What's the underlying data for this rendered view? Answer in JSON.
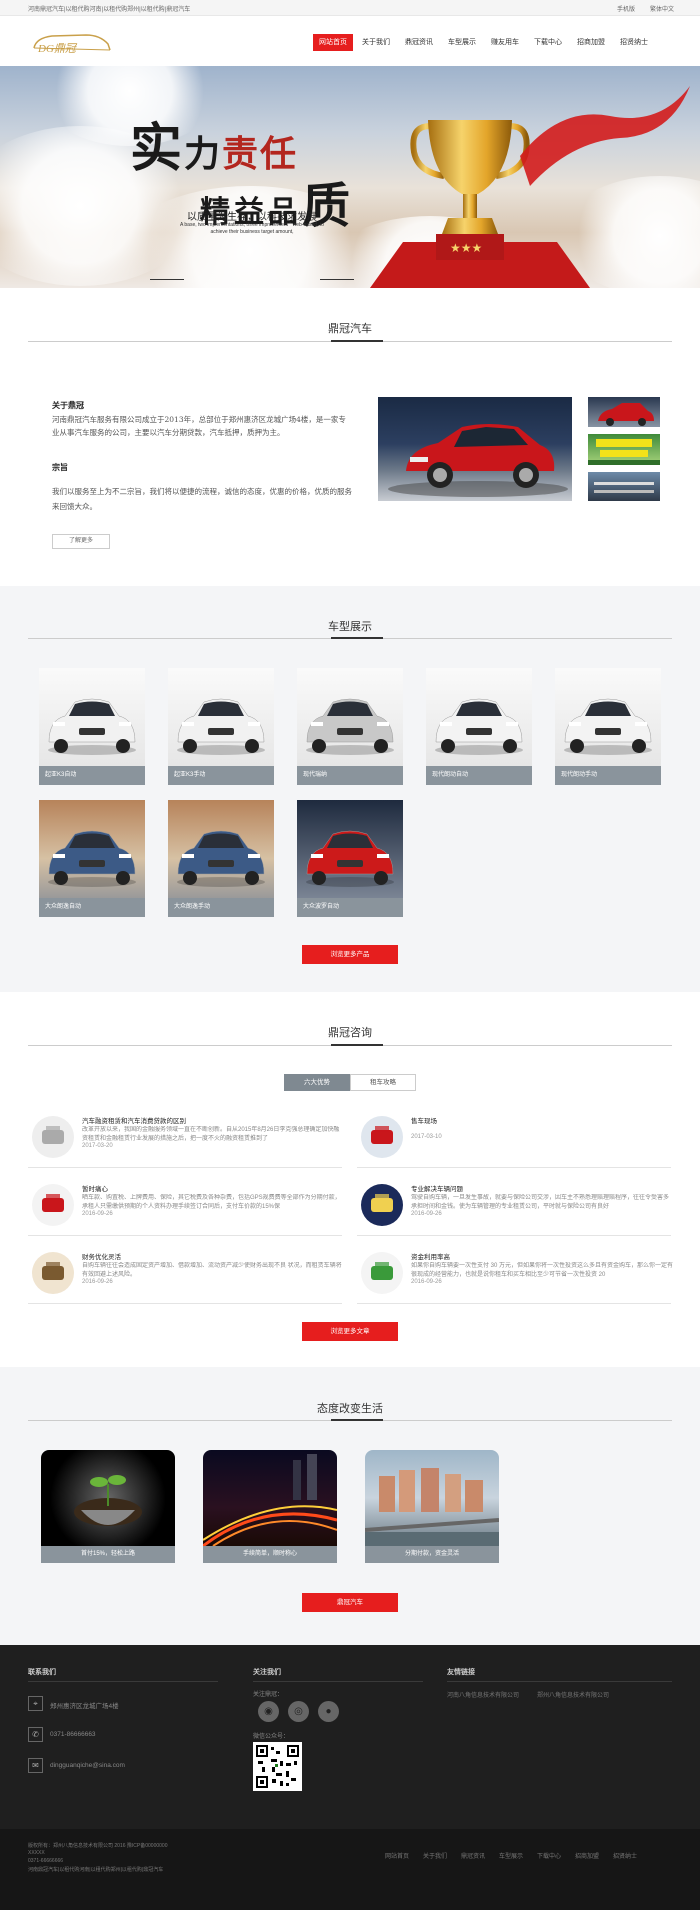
{
  "topbar": {
    "notice": "河南鼎冠汽车|以租代购河南|以租代购郑州|以租代购|鼎冠汽车",
    "mobile": "手机版",
    "lang": "繁体中文"
  },
  "header": {
    "logo_text": "DG鼎冠",
    "nav": [
      "网站首页",
      "关于我们",
      "鼎冠资讯",
      "车型展示",
      "赚友用车",
      "下载中心",
      "招商加盟",
      "招贤纳士"
    ]
  },
  "banner": {
    "title_a": "实",
    "title_b": "力",
    "title_c": "责任",
    "title_d": "精益品",
    "title_e": "质",
    "slogan": "以质量为生存，以科技求发展",
    "slogan_en": "A base, two implementations, three improvement \" web-based, to achieve their business target amount,"
  },
  "about": {
    "section_title": "鼎冠汽车",
    "heading1": "关于鼎冠",
    "text1": "河南鼎冠汽车服务有限公司成立于2013年，总部位于郑州惠济区龙城广场4楼，是一家专业从事汽车服务的公司，主要以汽车分期贷款，汽车抵押，质押为主。",
    "heading2": "宗旨",
    "text2": "我们以服务至上为不二宗旨，我们将以便捷的流程，诚信的态度，优惠的价格，优质的服务来回馈大众。",
    "more": "了解更多"
  },
  "models": {
    "section_title": "车型展示",
    "cars": [
      {
        "name": "起亚K3自动",
        "color": "#f1f1f1"
      },
      {
        "name": "起亚K3手动",
        "color": "#f1f1f1"
      },
      {
        "name": "现代瑞纳",
        "color": "#c8c8c8"
      },
      {
        "name": "现代朗动自动",
        "color": "#f3f3f3"
      },
      {
        "name": "现代朗动手动",
        "color": "#f3f3f3"
      },
      {
        "name": "大众朗逸自动",
        "color": "#3c5a86"
      },
      {
        "name": "大众朗逸手动",
        "color": "#3c5a86"
      },
      {
        "name": "大众波罗自动",
        "color": "#cc1a1a"
      }
    ],
    "more": "浏览更多产品"
  },
  "news": {
    "section_title": "鼎冠咨询",
    "tab_active": "六大优势",
    "tab_other": "租车攻略",
    "items": [
      {
        "title": "汽车融资租赁和汽车消费贷款的区别",
        "desc": "改革开放以来，我国的金融服务领域一直在不断创新。自从2015年8月26日李克强总理确定加快融资租赁和金融租赁行业发展的措施之后，把一度不火的融资租赁推到了",
        "date": "2017-03-20"
      },
      {
        "title": "售车现场",
        "desc": "",
        "date": "2017-03-10"
      },
      {
        "title": "暂时痛心",
        "desc": "晒车款、购置税、上牌费用、保险，其它税费及各种杂费，包括GPS规费费等全部作为分期付款，承租人只需缴供预期的个人资料办理手续签订合同后，支付车价款的15%保",
        "date": "2016-09-26"
      },
      {
        "title": "专业解决车辆问题",
        "desc": "驾驶自购车辆，一旦发生事故，就要与保险公司交涉，因车主不熟悉理赔理赔程序，往往令受害多承担时间和金钱。使为车辆管理的专业租赁公司，平时就与保险公司有良好",
        "date": "2016-09-26"
      },
      {
        "title": "财务优化灵活",
        "desc": "自购车辆往往会造成固定资产增加、借款增加、流动资产减少使财务出现不良 状况，而租赁车辆将有效回避上述风险。",
        "date": "2016-09-26"
      },
      {
        "title": "资金利用率高",
        "desc": "如果你自购车辆要一次性支付 30 万元，但如果你将一次性投资这么多且有资金购车，那么你一定有很现成的经营能力，也就是说你租车和买车相比至少可节省一次性投资 20",
        "date": "2016-09-26"
      }
    ],
    "more": "浏览更多文章"
  },
  "life": {
    "section_title": "态度改变生活",
    "items": [
      {
        "label": "首付15%，轻松上路"
      },
      {
        "label": "手续简单，顺时称心"
      },
      {
        "label": "分期付款，资金灵活"
      }
    ],
    "button": "鼎冠汽车"
  },
  "footer": {
    "contact_title": "联系我们",
    "address": "郑州惠济区龙城广场4楼",
    "phone": "0371-86666663",
    "email": "dingguanqiche@sina.com",
    "follow_title": "关注我们",
    "follow_sub": "关注鼎冠：",
    "wechat_label": "微信公众号：",
    "links_title": "友情链接",
    "link1": "河南八角信息技术有限公司",
    "link2": "郑州八角信息技术有限公司",
    "copyright_lines": [
      "版权所有：郑州八角信息技术有限公司 2016 豫ICP备00000000",
      "XXXXX",
      "0371-66666666",
      "河南鼎冠汽车|以租代购河南|以租代购郑州|以租代购|鼎冠汽车"
    ],
    "bottom_nav": [
      "网站首页",
      "关于我们",
      "鼎冠资讯",
      "车型展示",
      "下载中心",
      "招商加盟",
      "招贤纳士"
    ]
  },
  "colors": {
    "accent": "#e61e1e",
    "caption_gray": "#8a949c",
    "footer_bg": "#1f1f1f"
  }
}
